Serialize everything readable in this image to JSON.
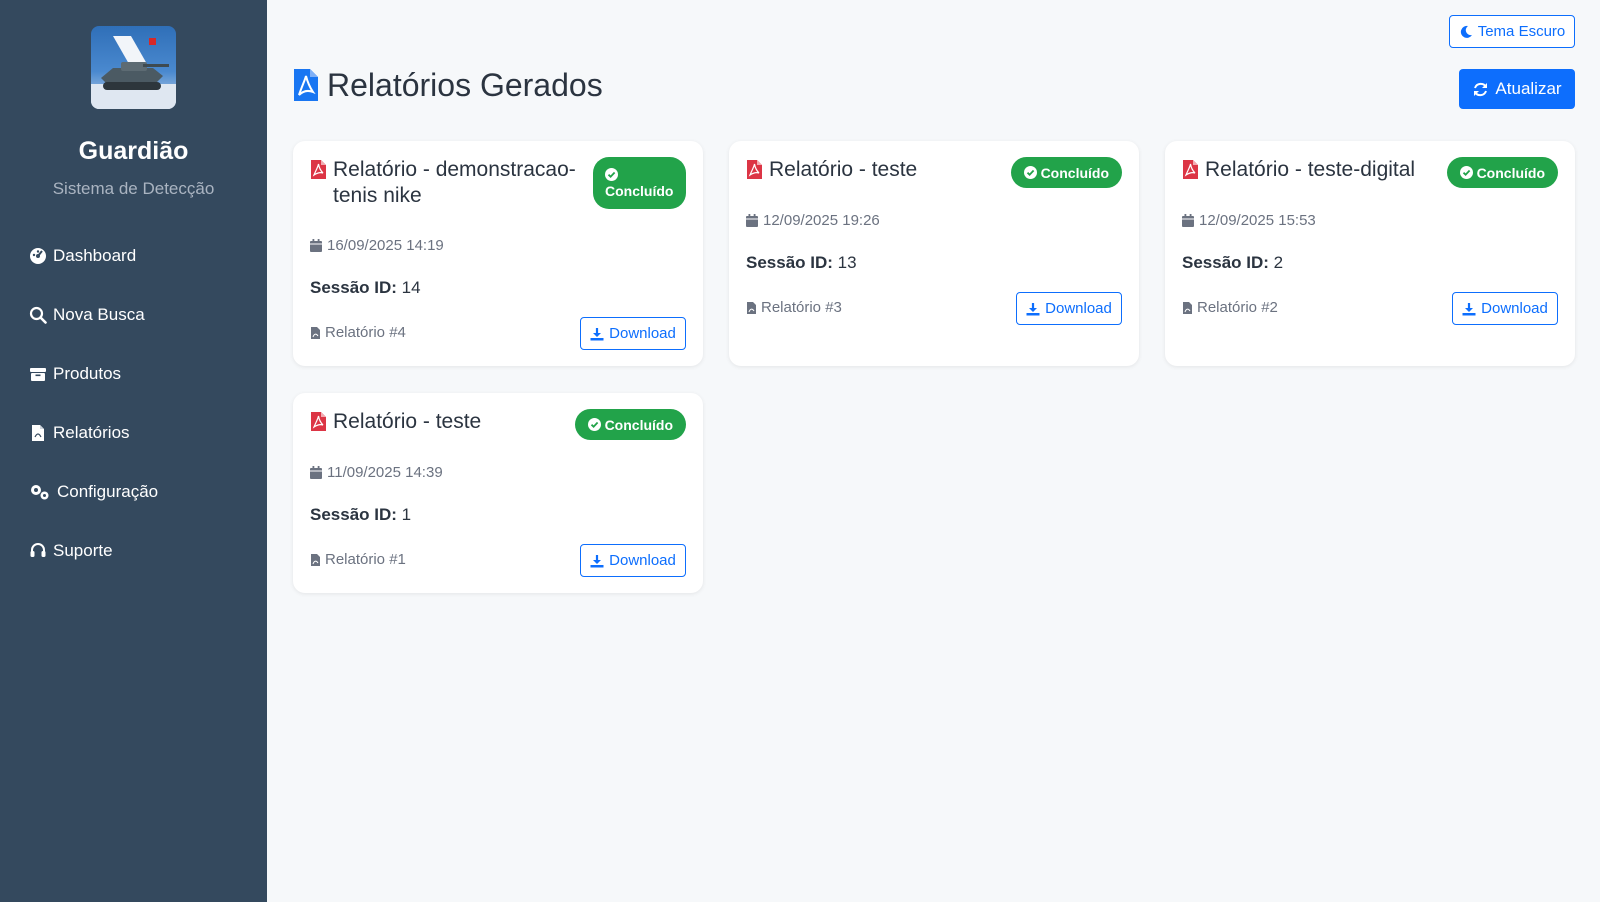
{
  "sidebar": {
    "brand": "Guardião",
    "subtitle": "Sistema de Detecção",
    "items": [
      {
        "label": "Dashboard",
        "icon": "dashboard-icon"
      },
      {
        "label": "Nova Busca",
        "icon": "search-icon"
      },
      {
        "label": "Produtos",
        "icon": "box-icon"
      },
      {
        "label": "Relatórios",
        "icon": "file-pdf-icon"
      },
      {
        "label": "Configuração",
        "icon": "gears-icon"
      },
      {
        "label": "Suporte",
        "icon": "headset-icon"
      }
    ]
  },
  "header": {
    "theme_button": "Tema Escuro",
    "title": "Relatórios Gerados",
    "refresh_button": "Atualizar"
  },
  "reports": [
    {
      "title": "Relatório - demonstracao-tenis nike",
      "status": "Concluído",
      "date": "16/09/2025 14:19",
      "session_label": "Sessão ID:",
      "session_id": "14",
      "report_label": "Relatório #4",
      "download": "Download"
    },
    {
      "title": "Relatório - teste",
      "status": "Concluído",
      "date": "12/09/2025 19:26",
      "session_label": "Sessão ID:",
      "session_id": "13",
      "report_label": "Relatório #3",
      "download": "Download"
    },
    {
      "title": "Relatório - teste-digital",
      "status": "Concluído",
      "date": "12/09/2025 15:53",
      "session_label": "Sessão ID:",
      "session_id": "2",
      "report_label": "Relatório #2",
      "download": "Download"
    },
    {
      "title": "Relatório - teste",
      "status": "Concluído",
      "date": "11/09/2025 14:39",
      "session_label": "Sessão ID:",
      "session_id": "1",
      "report_label": "Relatório #1",
      "download": "Download"
    }
  ],
  "colors": {
    "sidebar_bg": "#34495e",
    "accent": "#0d6efd",
    "success": "#22a34a",
    "pdf_red": "#dc3545"
  }
}
